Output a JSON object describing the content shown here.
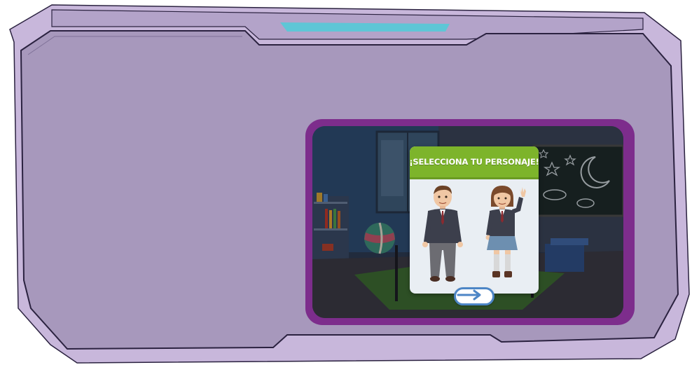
{
  "frame": {
    "outer_color": "#c8b7db",
    "inner_color": "#a798bc",
    "border_color": "#2b2240",
    "tab_accent_color": "#5ec6d6"
  },
  "video_panel": {
    "border_color": "#7d2d8c",
    "scene": "classroom"
  },
  "dialog": {
    "title": "¡SELECCIONA TU PERSONAJE!",
    "header_color": "#7db42b",
    "characters": [
      {
        "name": "boy",
        "icon": "boy-character-icon"
      },
      {
        "name": "girl",
        "icon": "girl-character-icon"
      }
    ],
    "next_button": {
      "icon": "arrow-right-icon",
      "color": "#4d86c6"
    }
  }
}
